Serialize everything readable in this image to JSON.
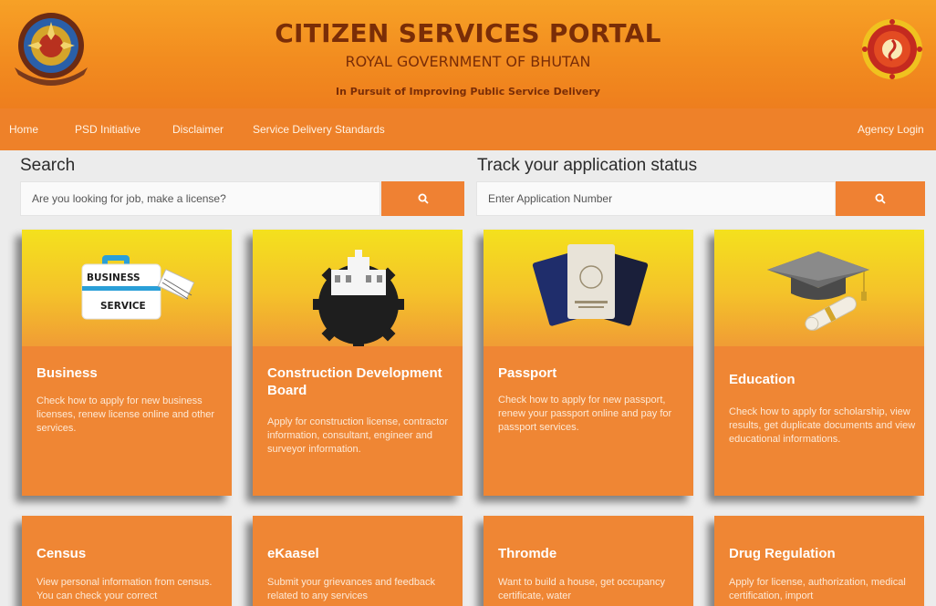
{
  "header": {
    "title": "CITIZEN SERVICES PORTAL",
    "subtitle": "ROYAL GOVERNMENT OF BHUTAN",
    "tagline": "In Pursuit of Improving Public Service Delivery",
    "left_emblem_icon": "bhutan-emblem-icon",
    "right_emblem_icon": "gnh-seal-icon"
  },
  "nav": {
    "items": [
      "Home",
      "PSD Initiative",
      "Disclaimer",
      "Service Delivery Standards"
    ],
    "agency_login": "Agency Login"
  },
  "search": {
    "label": "Search",
    "placeholder": "Are you looking for job, make a license?",
    "button_icon": "search-icon"
  },
  "track": {
    "label": "Track your application status",
    "placeholder": "Enter Application Number",
    "button_icon": "search-icon"
  },
  "cards": [
    {
      "title": "Business",
      "description": "Check how to apply for new business licenses, renew license online and other services.",
      "image_text": [
        "BUSINESS",
        "SERVICE"
      ],
      "icon": "briefcase-icon"
    },
    {
      "title": "Construction Development Board",
      "description": "Apply for construction license, contractor information, consultant, engineer and surveyor information.",
      "icon": "gear-building-icon"
    },
    {
      "title": "Passport",
      "description": "Check how to apply for new passport, renew your passport online and pay for passport services.",
      "icon": "passport-icon"
    },
    {
      "title": "Education",
      "description": "Check how to apply for scholarship, view results, get duplicate documents and view educational informations.",
      "icon": "graduation-cap-icon"
    },
    {
      "title": "Census",
      "description": "View personal information from census. You can check your correct"
    },
    {
      "title": "eKaasel",
      "description": "Submit your grievances and feedback related to any services"
    },
    {
      "title": "Thromde",
      "description": "Want to build a house, get occupancy certificate, water"
    },
    {
      "title": "Drug Regulation",
      "description": "Apply for license, authorization, medical certification, import"
    }
  ],
  "colors": {
    "header_orange": "#f28c1f",
    "nav_orange": "#ee8129",
    "card_orange": "#ef8634",
    "card_yellow": "#f4e11d",
    "title_brown": "#7a2d07"
  }
}
